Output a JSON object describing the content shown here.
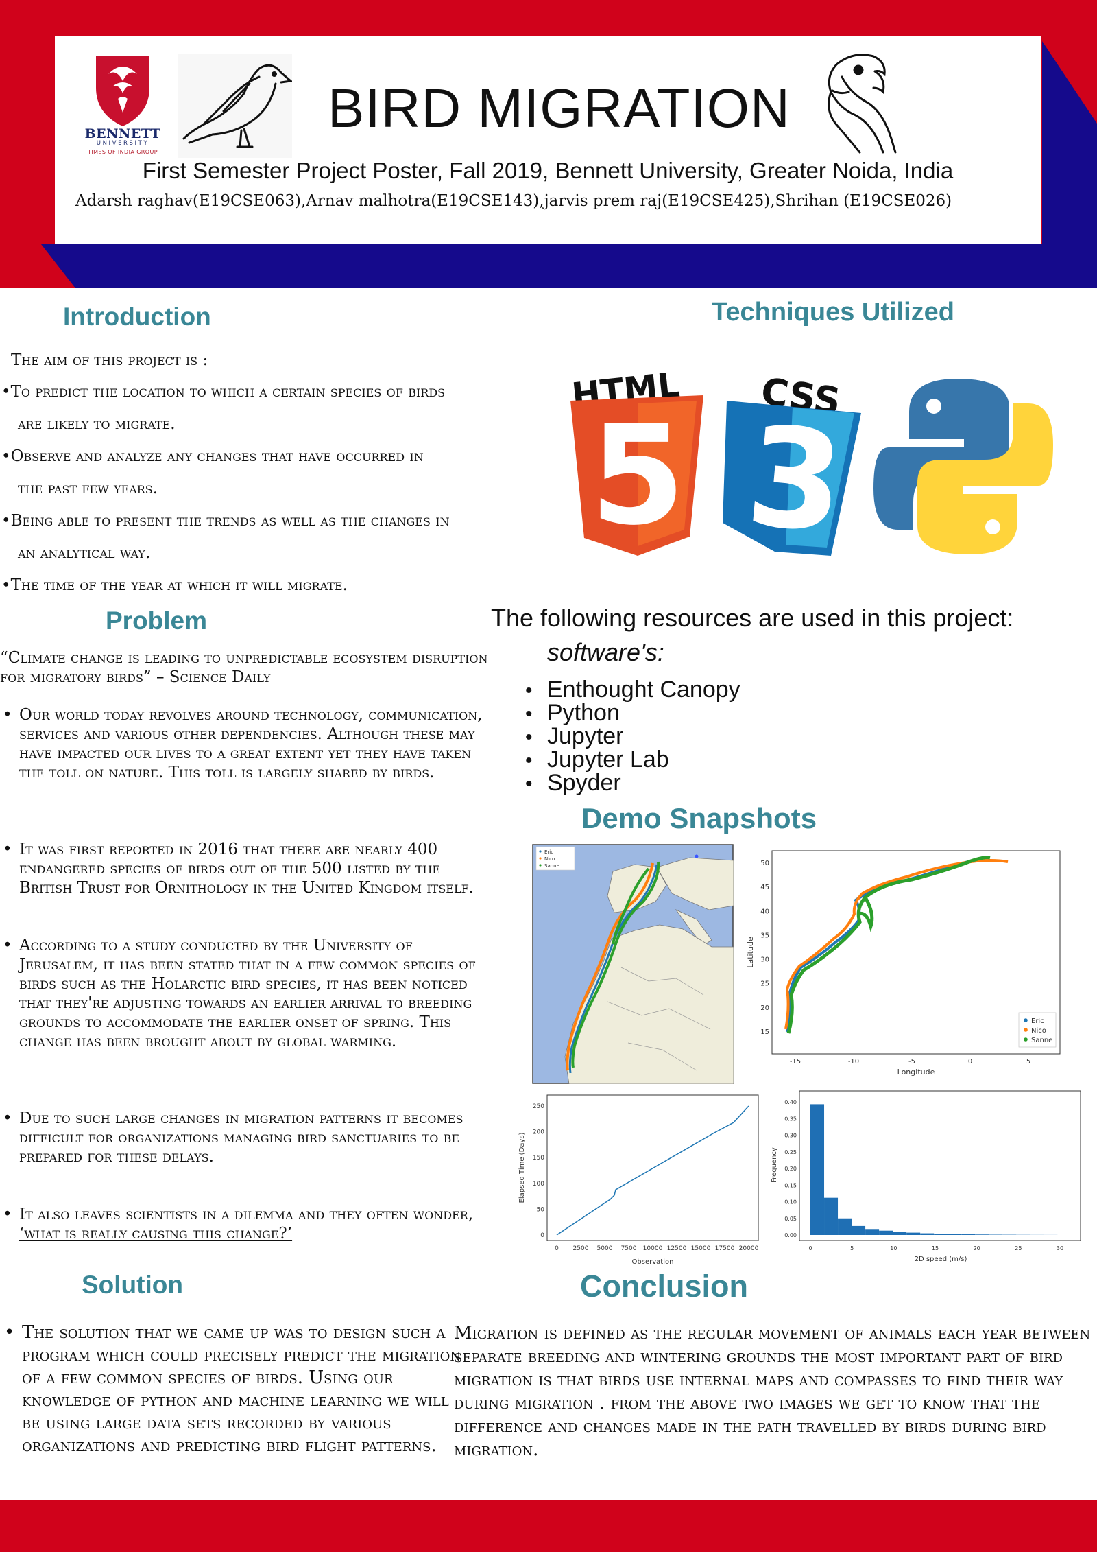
{
  "header": {
    "title": "BIRD MIGRATION",
    "subtitle": "First Semester Project Poster, Fall 2019, Bennett University, Greater Noida, India",
    "authors": "Adarsh raghav(E19CSE063),Arnav malhotra(E19CSE143),jarvis prem raj(E19CSE425),Shrihan (E19CSE026)",
    "logo": {
      "name": "BENNETT",
      "sub": "UNIVERSITY",
      "tag": "TIMES OF INDIA GROUP"
    },
    "icons": [
      "bennett-logo-icon",
      "bird-sketch-icon",
      "parrot-icon"
    ]
  },
  "colors": {
    "red": "#d0021b",
    "navy": "#150a8c",
    "heading": "#3a8796"
  },
  "introduction": {
    "heading": "Introduction",
    "lead": "The aim of this project is :",
    "items": [
      {
        "line1": "•To predict the location to which a certain species of birds",
        "line2": "are likely to migrate."
      },
      {
        "line1": "•Observe and analyze any changes that have occurred in",
        "line2": "the past few years."
      },
      {
        "line1": "•Being able to present the trends as well as the changes in",
        "line2": "an  analytical way."
      },
      {
        "line1": "•The time of the year at which it will migrate.",
        "line2": ""
      }
    ]
  },
  "problem": {
    "heading": "Problem",
    "quote": "“Climate change is leading to unpredictable ecosystem disruption for migratory birds” – Science Daily",
    "items": [
      "Our world today revolves around technology, communication, services and various other dependencies. Although these may have impacted our lives to a great extent yet they have taken the toll on nature. This toll is largely shared by birds.",
      "It was first reported in 2016 that there are nearly 400 endangered species of birds out of the 500 listed by the British Trust for Ornithology in the United Kingdom itself.",
      "According to a study conducted by the University of Jerusalem, it has been stated that in a few common species of birds such as the Holarctic bird species, it has been noticed that they're adjusting towards an earlier arrival to breeding grounds to accommodate the earlier onset of spring. This change has been brought about by global warming.",
      "Due to such large changes in migration patterns it becomes difficult for organizations managing bird sanctuaries to be prepared for these delays."
    ],
    "last_item_prefix": "It also leaves scientists in a dilemma and they often wonder, ",
    "last_item_link": "‘what is really causing this change?’"
  },
  "techniques": {
    "heading": "Techniques Utilized",
    "logos": {
      "html": "HTML",
      "html_num": "5",
      "css": "CSS",
      "css_num": "3"
    },
    "resources_intro": "The following resources are used in this project:",
    "software_title": "software's:",
    "software": [
      "Enthought  Canopy",
      "Python",
      "Jupyter",
      "Jupyter Lab",
      "Spyder"
    ]
  },
  "demo": {
    "heading": "Demo Snapshots",
    "legend": [
      "Eric",
      "Nico",
      "Sanne"
    ],
    "series_colors": [
      "#1f77b4",
      "#ff7f0e",
      "#2ca02c"
    ],
    "scatter": {
      "xlabel": "Longitude",
      "ylabel": "Latitude",
      "xticks": [
        "-15",
        "-10",
        "-5",
        "0",
        "5"
      ],
      "yticks": [
        "15",
        "20",
        "25",
        "30",
        "35",
        "40",
        "45",
        "50"
      ]
    },
    "elapsed": {
      "xlabel": "Observation",
      "ylabel": "Elapsed Time (Days)",
      "xticks": [
        "0",
        "2500",
        "5000",
        "7500",
        "10000",
        "12500",
        "15000",
        "17500",
        "20000"
      ],
      "yticks": [
        "0",
        "50",
        "100",
        "150",
        "200",
        "250"
      ]
    },
    "histogram": {
      "xlabel": "2D speed (m/s)",
      "ylabel": "Frequency",
      "xticks": [
        "0",
        "5",
        "10",
        "15",
        "20",
        "25",
        "30"
      ],
      "yticks": [
        "0.00",
        "0.05",
        "0.10",
        "0.15",
        "0.20",
        "0.25",
        "0.30",
        "0.35",
        "0.40"
      ],
      "bins": [
        0.393,
        0.112,
        0.05,
        0.027,
        0.018,
        0.013,
        0.01,
        0.007,
        0.005,
        0.004,
        0.003,
        0.002,
        0.0015,
        0.001,
        0.0008,
        0.0005,
        0.0003,
        0.0002
      ]
    }
  },
  "solution": {
    "heading": "Solution",
    "text": "The solution that we came up was to design such a program which could precisely predict the migration of a few common species of birds. Using our knowledge of python and machine learning we will be using large data sets recorded by various organizations and predicting bird flight patterns."
  },
  "conclusion": {
    "heading": "Conclusion",
    "text": "Migration is defined as the regular movement of animals each year between separate breeding and wintering grounds the most  important part of bird migration is that birds use  internal maps and  compasses to find their way during migration . from the above two images we get to know that the difference and changes made in the path travelled by birds during bird migration."
  }
}
